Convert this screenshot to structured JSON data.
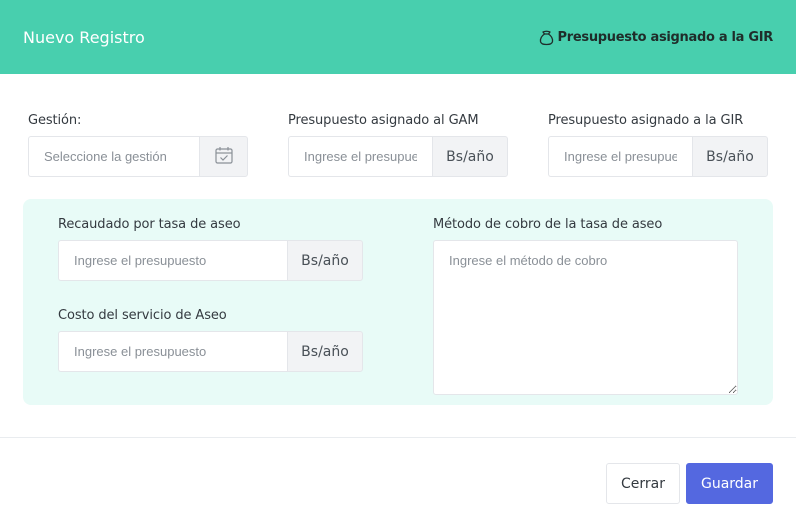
{
  "header": {
    "title": "Nuevo Registro",
    "subtitle": "Presupuesto asignado a la GIR",
    "subtitle_icon": "money-bag-icon",
    "color": "#48cfae"
  },
  "form": {
    "gestion": {
      "label": "Gestión:",
      "placeholder": "Seleccione la gestión",
      "icon": "calendar-check-icon"
    },
    "gam": {
      "label": "Presupuesto asignado al GAM",
      "placeholder": "Ingrese el presupuesto",
      "unit": "Bs/año"
    },
    "gir": {
      "label": "Presupuesto asignado a la GIR",
      "placeholder": "Ingrese el presupuesto",
      "unit": "Bs/año"
    },
    "recaudado": {
      "label": "Recaudado por tasa de aseo",
      "placeholder": "Ingrese el presupuesto",
      "unit": "Bs/año"
    },
    "costo": {
      "label": "Costo del servicio de Aseo",
      "placeholder": "Ingrese el presupuesto",
      "unit": "Bs/año"
    },
    "metodo": {
      "label": "Método de cobro de la tasa de aseo",
      "placeholder": "Ingrese el método de cobro"
    }
  },
  "footer": {
    "close_label": "Cerrar",
    "save_label": "Guardar",
    "save_color": "#5468e0"
  }
}
